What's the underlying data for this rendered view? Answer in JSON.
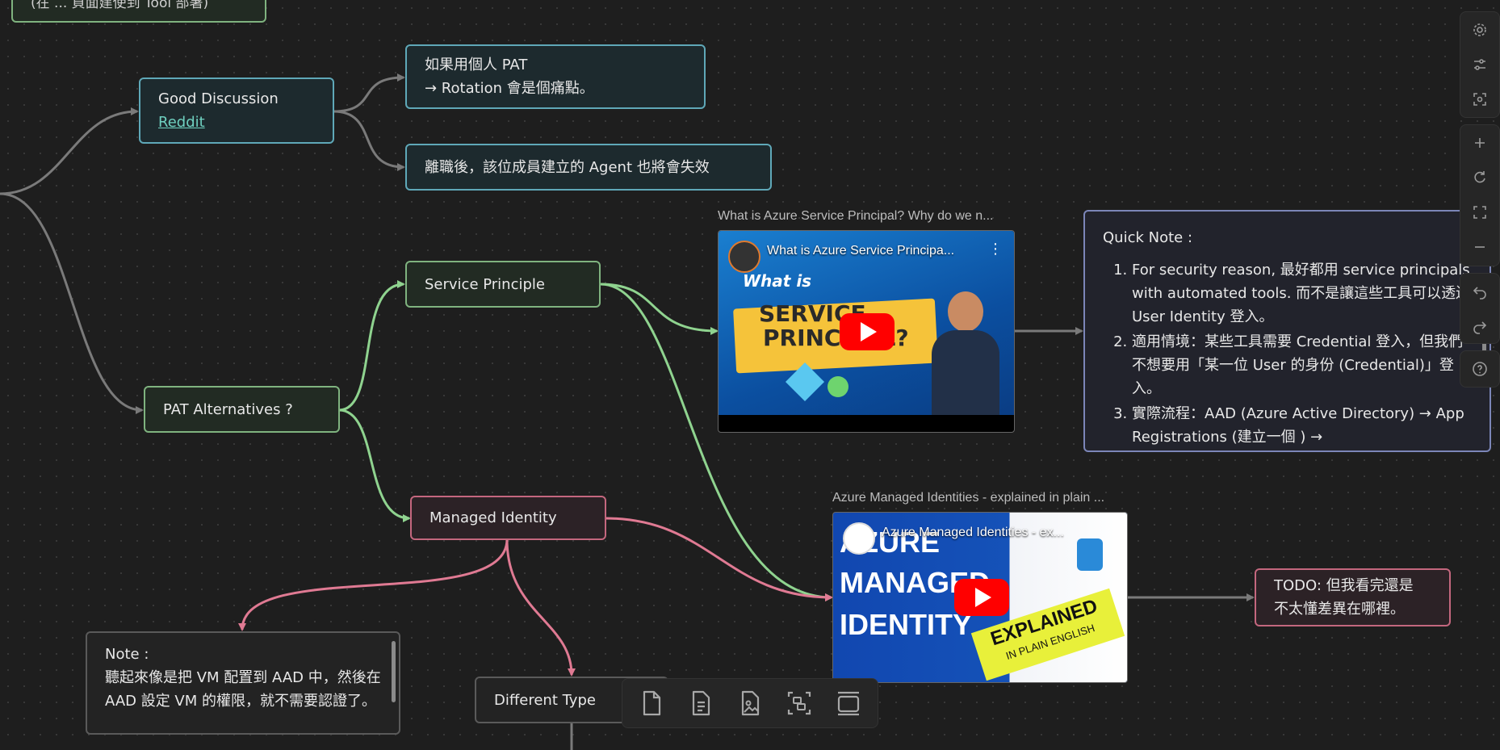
{
  "nodes": {
    "top_partial": "(在 ... 頁面建使到 Tool 部署)",
    "good_discussion": {
      "title": "Good Discussion",
      "link": "Reddit"
    },
    "pat_personal": {
      "line1": "如果用個人 PAT",
      "line2": "→ Rotation 會是個痛點。"
    },
    "leave": "離職後，該位成員建立的 Agent 也將會失效",
    "service_principle": "Service Principle",
    "pat_alternatives": "PAT Alternatives ?",
    "managed_identity": "Managed Identity",
    "todo": {
      "line1": "TODO: 但我看完還是",
      "line2": "不太懂差異在哪裡。"
    },
    "different_type": "Different Type"
  },
  "videos": {
    "sp": {
      "caption": "What is Azure Service Principal? Why do we n...",
      "player_title": "What is Azure Service Principa...",
      "thumb_lines": [
        "What is",
        "SERVICE",
        "PRINCIPAL?"
      ]
    },
    "mi": {
      "caption": "Azure Managed Identities - explained in plain ...",
      "player_title": "Azure Managed Identities - ex...",
      "thumb_lines": [
        "AZURE",
        "MANAGED",
        "IDENTITY"
      ],
      "badge1": "EXPLAINED",
      "badge2": "IN PLAIN ENGLISH"
    }
  },
  "quick_note": {
    "heading": "Quick Note :",
    "items": [
      "For security reason, 最好都用 service principals with automated tools. 而不是讓這些工具可以透過 User Identity 登入。",
      "適用情境：某些工具需要 Credential 登入，但我們不想要用「某一位 User 的身份 (Credential)」登入。",
      "實際流程：AAD (Azure Active Directory) → App Registrations (建立一個 ) →"
    ]
  },
  "note": {
    "heading": "Note :",
    "body": "聽起來像是把 VM 配置到 AAD 中，然後在 AAD 設定 VM 的權限，就不需要認證了。"
  },
  "right_toolbar": {
    "icons": [
      "gear-icon",
      "sliders-icon",
      "focus-icon",
      "zoom-in-icon",
      "reset-icon",
      "fullscreen-icon",
      "zoom-out-icon",
      "undo-icon",
      "redo-icon",
      "help-icon"
    ]
  },
  "bottom_toolbar": {
    "icons": [
      "new-card-icon",
      "new-note-icon",
      "media-file-icon",
      "group-icon",
      "slide-icon"
    ]
  },
  "colors": {
    "teal": "#5fa8b8",
    "green": "#7fb37f",
    "pink": "#e07a93",
    "gray": "#7a7a7a",
    "quick_border": "#7c86b8"
  }
}
